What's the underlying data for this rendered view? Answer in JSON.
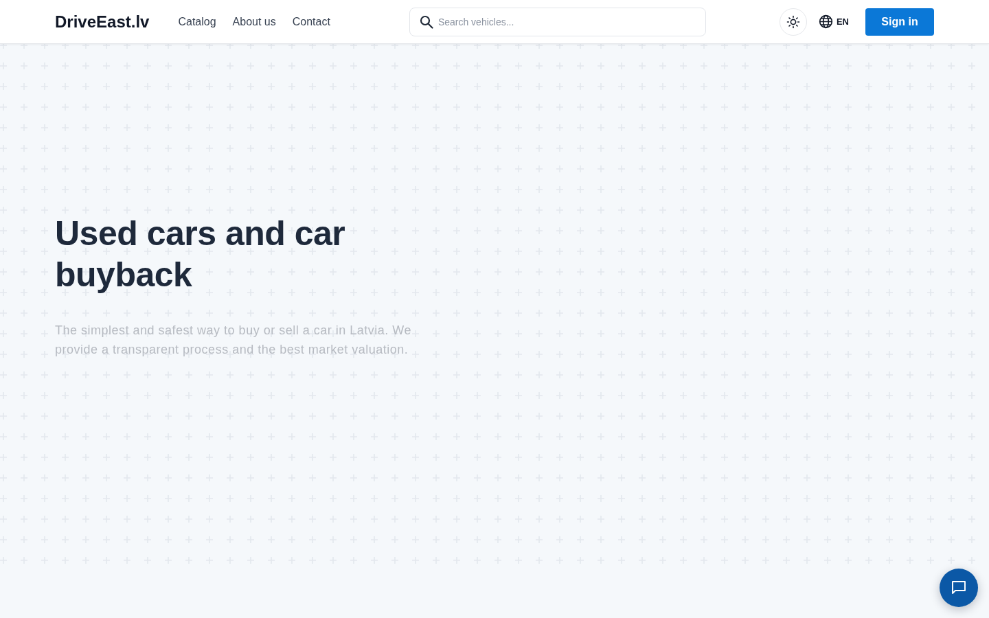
{
  "header": {
    "logo": "DriveEast.lv",
    "nav": [
      "Catalog",
      "About us",
      "Contact"
    ],
    "search": {
      "placeholder": "Search vehicles..."
    },
    "language": "EN",
    "sign_in": "Sign in"
  },
  "hero": {
    "title": "Used cars and car buyback",
    "subtitle": "The simplest and safest way to buy or sell a car in Latvia. We provide a transparent process and the best market valuation."
  }
}
